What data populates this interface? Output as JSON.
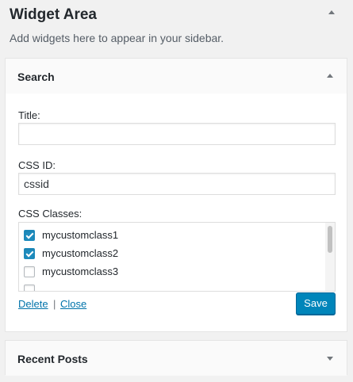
{
  "area": {
    "title": "Widget Area",
    "description": "Add widgets here to appear in your sidebar."
  },
  "search_widget": {
    "name": "Search",
    "title_label": "Title:",
    "title_value": "",
    "css_id_label": "CSS ID:",
    "css_id_value": "cssid",
    "css_classes_label": "CSS Classes:",
    "classes": [
      {
        "label": "mycustomclass1",
        "checked": true
      },
      {
        "label": "mycustomclass2",
        "checked": true
      },
      {
        "label": "mycustomclass3",
        "checked": false
      },
      {
        "label": "",
        "checked": false
      }
    ],
    "delete_label": "Delete",
    "separator": "|",
    "close_label": "Close",
    "save_label": "Save"
  },
  "recent_posts_widget": {
    "name": "Recent Posts"
  },
  "icons": {
    "area_toggle": "caret-up-icon",
    "search_toggle": "caret-up-icon",
    "recent_toggle": "caret-down-icon"
  },
  "colors": {
    "accent": "#0085ba",
    "link": "#0073aa",
    "checkbox": "#1e8cbe"
  }
}
